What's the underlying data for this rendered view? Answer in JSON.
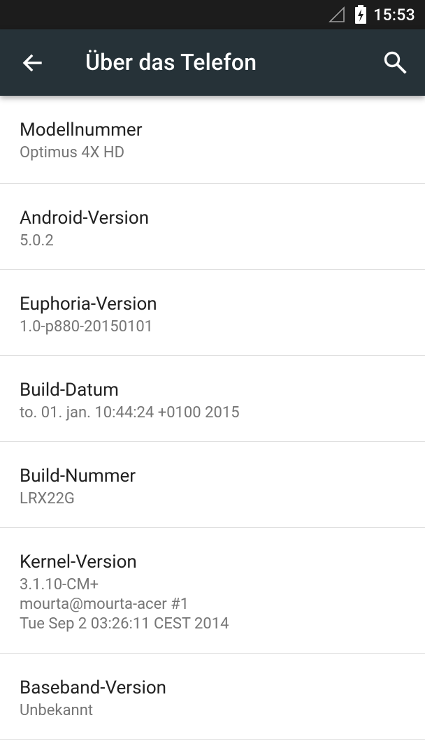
{
  "status_bar": {
    "time": "15:53",
    "signal_icon": "signal-empty-icon",
    "battery_icon": "battery-charging-icon"
  },
  "app_bar": {
    "title": "Über das Telefon",
    "back_icon": "arrow-back-icon",
    "search_icon": "search-icon",
    "color": "#263238"
  },
  "items": [
    {
      "title": "Modellnummer",
      "summary": "Optimus 4X HD"
    },
    {
      "title": "Android-Version",
      "summary": "5.0.2"
    },
    {
      "title": "Euphoria-Version",
      "summary": "1.0-p880-20150101"
    },
    {
      "title": "Build-Datum",
      "summary": "to. 01. jan. 10:44:24 +0100 2015"
    },
    {
      "title": "Build-Nummer",
      "summary": "LRX22G"
    },
    {
      "title": "Kernel-Version",
      "summary": "3.1.10-CM+\nmourta@mourta-acer #1\nTue Sep 2 03:26:11 CEST 2014"
    },
    {
      "title": "Baseband-Version",
      "summary": "Unbekannt"
    }
  ]
}
